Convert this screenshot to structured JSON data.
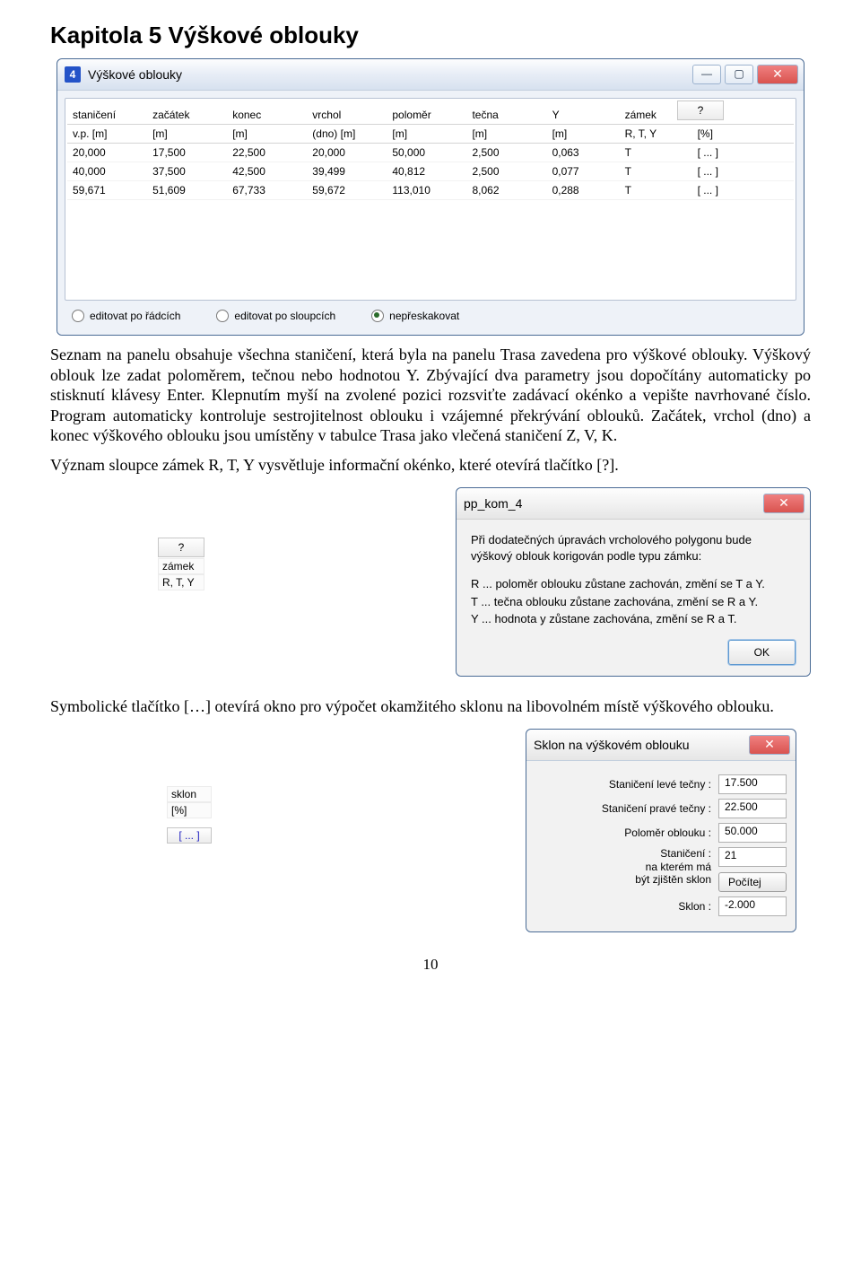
{
  "chapter_title": "Kapitola 5  Výškové oblouky",
  "paragraph1": "Seznam na panelu obsahuje všechna staničení, která byla na panelu Trasa zavedena pro výškové oblouky. Výškový oblouk lze zadat poloměrem, tečnou nebo hodnotou Y. Zbývající dva parametry jsou dopočítány automaticky po stisknutí klávesy Enter. Klepnutím myší na zvolené pozici rozsviťte zadávací okénko a vepište navrhované číslo. Program automaticky kontroluje sestrojitelnost oblouku i vzájemné překrývání oblouků. Začátek, vrchol (dno) a konec výškového oblouku jsou umístěny v tabulce Trasa jako vlečená staničení Z, V, K.",
  "paragraph2": "Význam sloupce zámek R, T, Y vysvětluje informační okénko, které otevírá tlačítko [?].",
  "paragraph3": "Symbolické tlačítko […] otevírá okno pro výpočet okamžitého sklonu na libovolném místě výškového oblouku.",
  "page_number": "10",
  "win1": {
    "icon_label": "4",
    "title": "Výškové oblouky",
    "help_label": "?",
    "headers1": [
      "staničení",
      "začátek",
      "konec",
      "vrchol",
      "poloměr",
      "tečna",
      "Y",
      "zámek",
      "sklon"
    ],
    "headers2": [
      "v.p. [m]",
      "[m]",
      "[m]",
      "(dno) [m]",
      "[m]",
      "[m]",
      "[m]",
      "R, T, Y",
      "[%]"
    ],
    "rows": [
      [
        "20,000",
        "17,500",
        "22,500",
        "20,000",
        "50,000",
        "2,500",
        "0,063",
        "T",
        "[ ... ]"
      ],
      [
        "40,000",
        "37,500",
        "42,500",
        "39,499",
        "40,812",
        "2,500",
        "0,077",
        "T",
        "[ ... ]"
      ],
      [
        "59,671",
        "51,609",
        "67,733",
        "59,672",
        "113,010",
        "8,062",
        "0,288",
        "T",
        "[ ... ]"
      ]
    ],
    "radios": [
      {
        "label": "editovat po řádcích",
        "checked": false
      },
      {
        "label": "editovat po sloupcích",
        "checked": false
      },
      {
        "label": "nepřeskakovat",
        "checked": true
      }
    ],
    "btn_min": "—",
    "btn_max": "▢",
    "btn_close": "✕"
  },
  "zamek_snip": {
    "help": "?",
    "l1": "zámek",
    "l2": "R, T, Y"
  },
  "dlg2": {
    "title": "pp_kom_4",
    "close": "✕",
    "p1": "Při dodatečných úpravách vrcholového polygonu bude výškový oblouk korigován podle typu zámku:",
    "r_line": "R ... poloměr oblouku zůstane zachován, změní se T a Y.",
    "t_line": "T ... tečna oblouku zůstane zachována, změní se R a Y.",
    "y_line": "Y ... hodnota y zůstane zachována, změní se R a T.",
    "ok": "OK"
  },
  "sklon_snip": {
    "l1": "sklon",
    "l2": "[%]",
    "cell": "[ ... ]"
  },
  "dlg3": {
    "title": "Sklon na výškovém oblouku",
    "close": "✕",
    "rows": [
      {
        "label": "Staničení levé tečny :",
        "value": "17.500"
      },
      {
        "label": "Staničení pravé tečny :",
        "value": "22.500"
      },
      {
        "label": "Poloměr oblouku :",
        "value": "50.000"
      }
    ],
    "stan_label": "Staničení :\nna kterém má\nbýt zjištěn sklon",
    "stan_value": "21",
    "compute": "Počítej",
    "sklon_label": "Sklon :",
    "sklon_value": "-2.000"
  }
}
